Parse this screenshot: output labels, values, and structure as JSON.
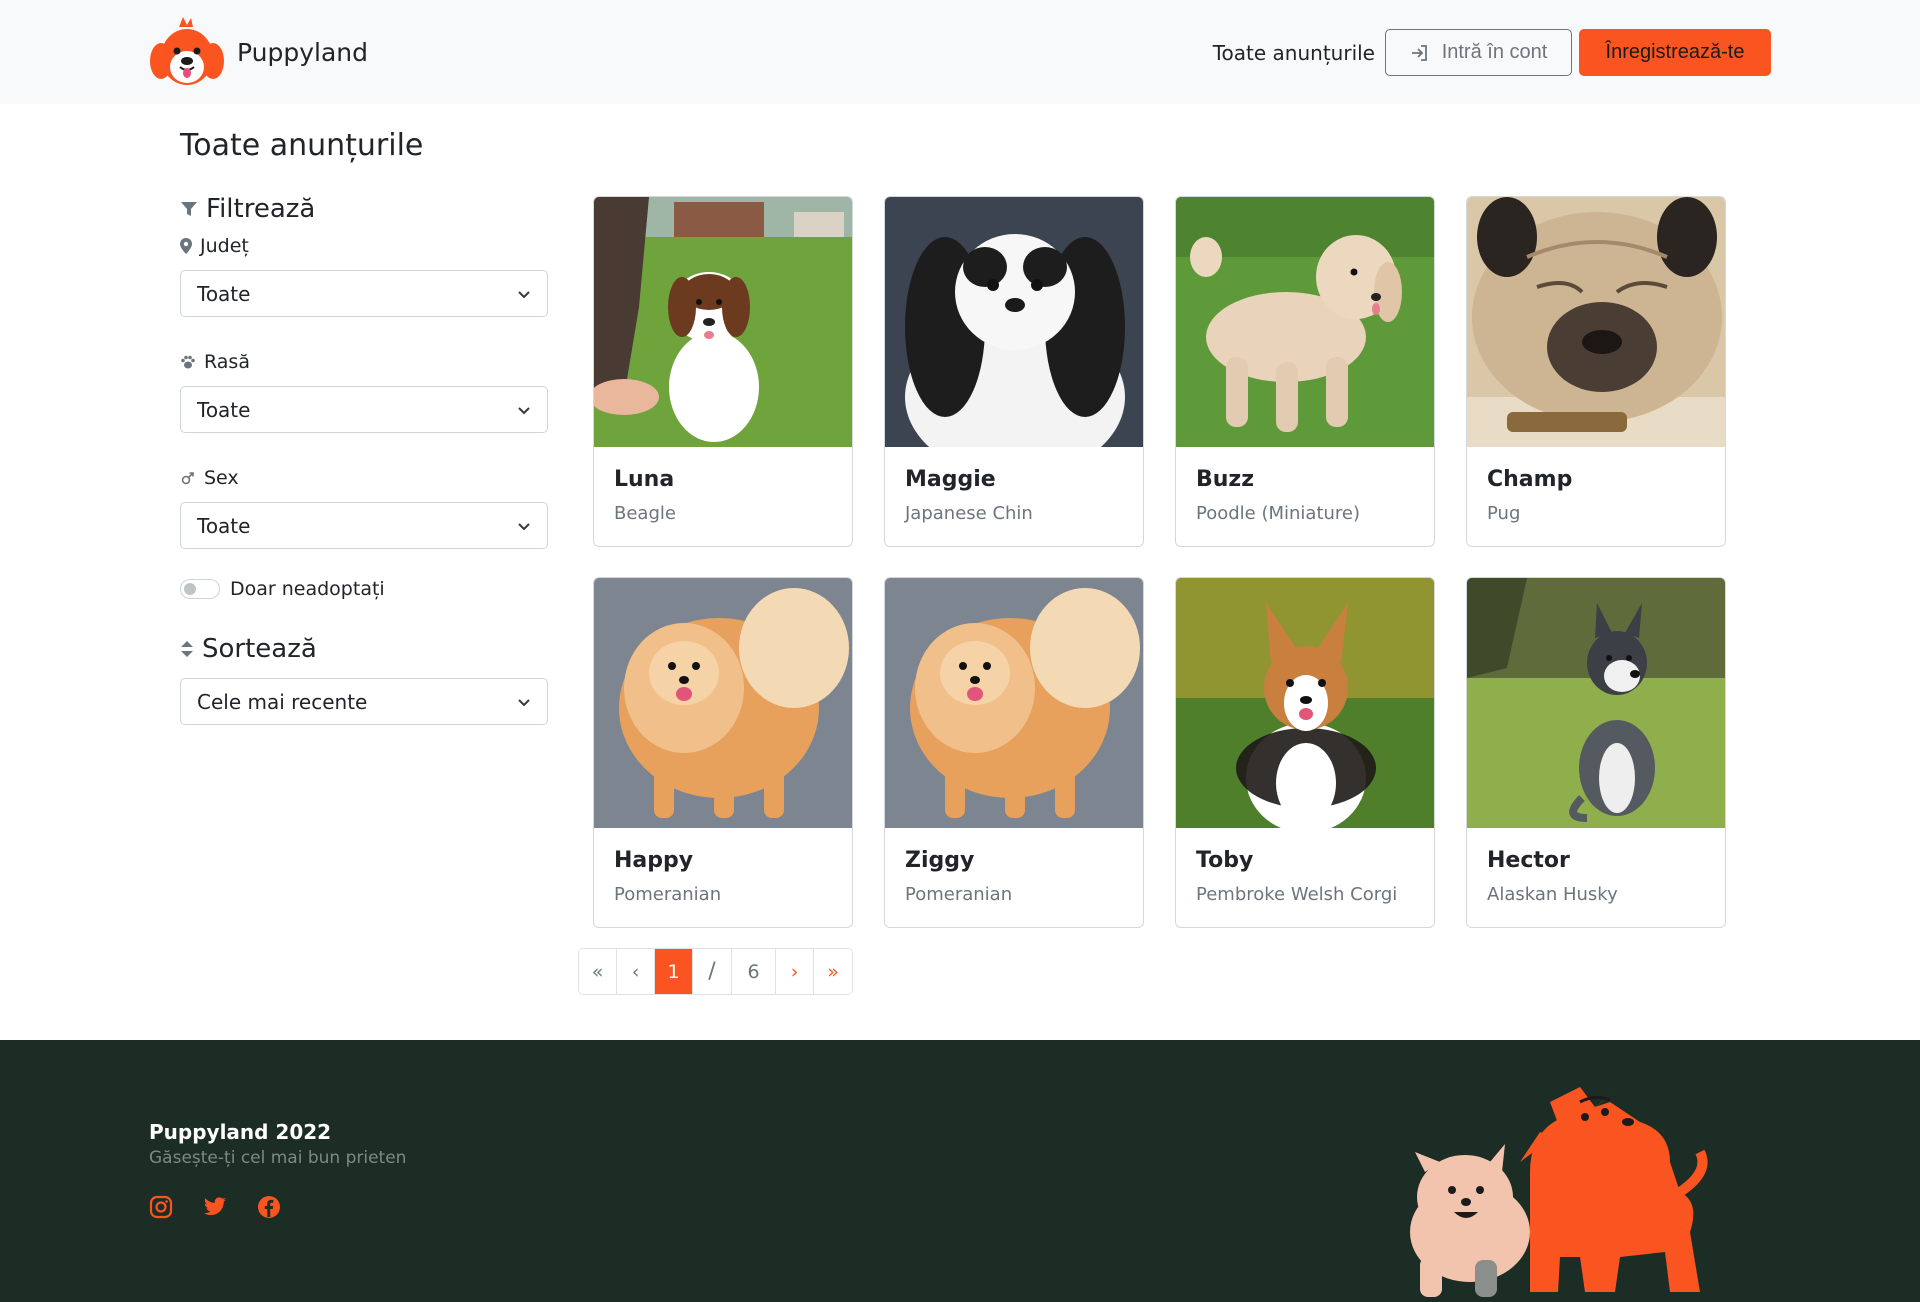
{
  "header": {
    "brand_name": "Puppyland",
    "nav_all_listings": "Toate anunțurile",
    "login_label": "Intră în cont",
    "register_label": "Înregistrează-te"
  },
  "main": {
    "page_title": "Toate anunțurile"
  },
  "filters": {
    "title": "Filtrează",
    "county": {
      "label": "Județ",
      "value": "Toate"
    },
    "breed": {
      "label": "Rasă",
      "value": "Toate"
    },
    "sex": {
      "label": "Sex",
      "value": "Toate"
    },
    "only_unadopted": {
      "label": "Doar neadoptați",
      "checked": false
    }
  },
  "sort": {
    "title": "Sortează",
    "value": "Cele mai recente"
  },
  "listings": [
    {
      "name": "Luna",
      "breed": "Beagle",
      "photo": "puppy-on-grass"
    },
    {
      "name": "Maggie",
      "breed": "Japanese Chin",
      "photo": "black-white-dog"
    },
    {
      "name": "Buzz",
      "breed": "Poodle (Miniature)",
      "photo": "poodle-on-grass"
    },
    {
      "name": "Champ",
      "breed": "Pug",
      "photo": "sleeping-pug"
    },
    {
      "name": "Happy",
      "breed": "Pomeranian",
      "photo": "pomeranian"
    },
    {
      "name": "Ziggy",
      "breed": "Pomeranian",
      "photo": "pomeranian"
    },
    {
      "name": "Toby",
      "breed": "Pembroke Welsh Corgi",
      "photo": "corgi-on-grass"
    },
    {
      "name": "Hector",
      "breed": "Alaskan Husky",
      "photo": "husky-puppy"
    }
  ],
  "pagination": {
    "first": "«",
    "prev": "‹",
    "current": "1",
    "separator": "/",
    "total": "6",
    "next": "›",
    "last": "»"
  },
  "footer": {
    "title": "Puppyland 2022",
    "tagline": "Găsește-ți cel mai bun prieten",
    "socials": [
      "instagram-icon",
      "twitter-icon",
      "facebook-icon"
    ]
  },
  "colors": {
    "accent": "#fa5421",
    "footer_bg": "#1b2d25",
    "header_bg": "#f8f9fa"
  }
}
